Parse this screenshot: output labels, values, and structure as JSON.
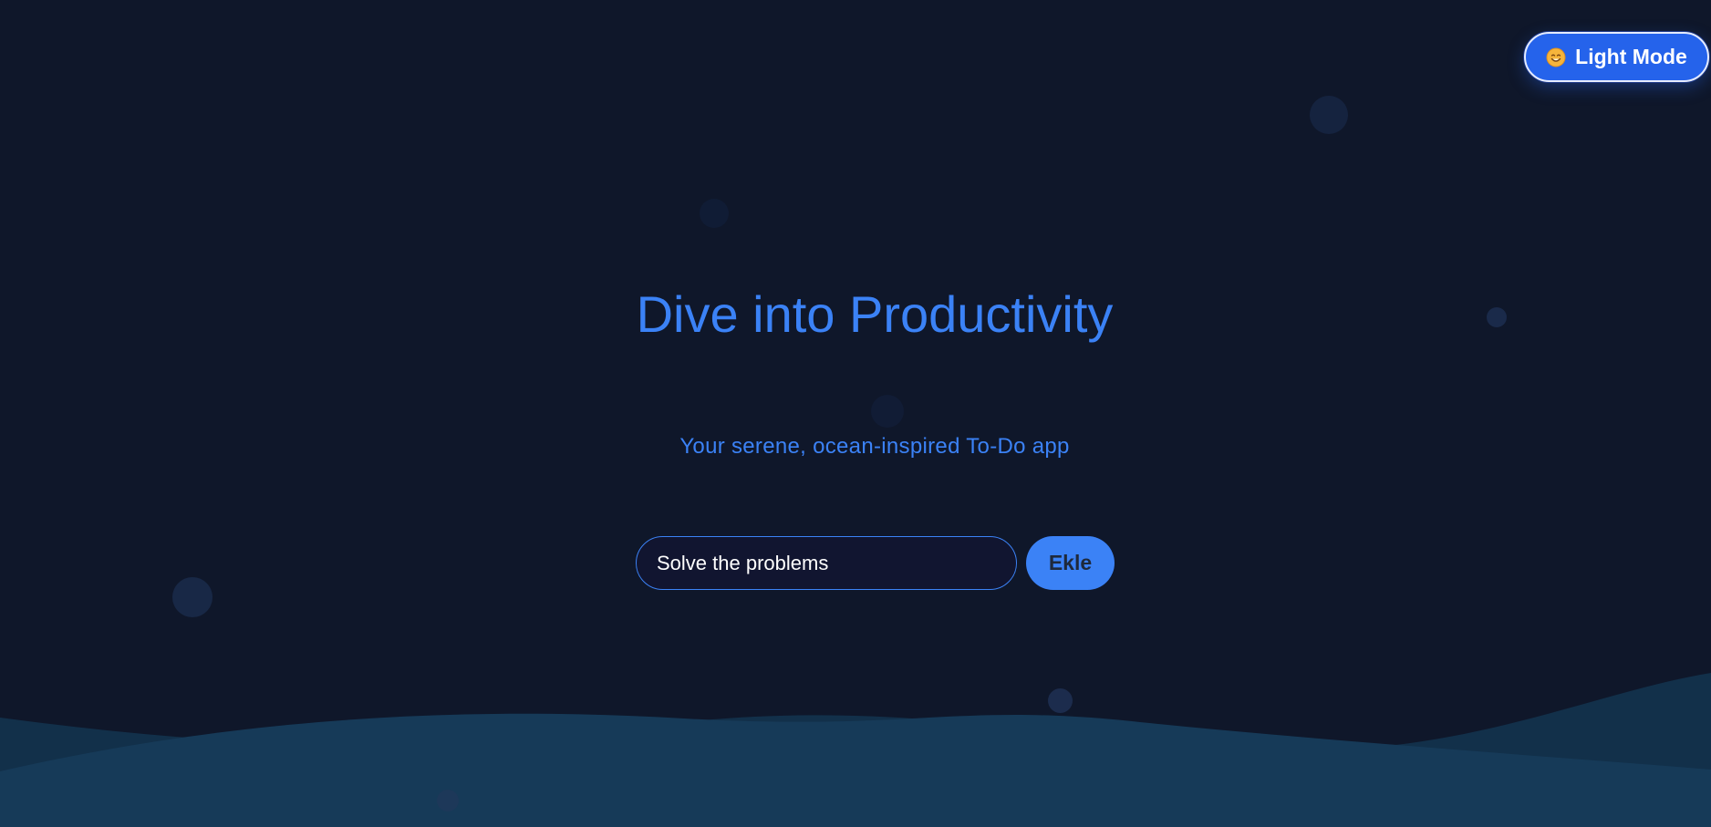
{
  "theme_toggle": {
    "icon": "sun-face-icon",
    "label": "Light Mode",
    "accent": "#2563eb"
  },
  "hero": {
    "title": "Dive into Productivity",
    "subtitle": "Your serene, ocean-inspired To-Do app"
  },
  "task_form": {
    "input_value": "Solve the problems",
    "add_label": "Ekle"
  },
  "colors": {
    "background": "#0f172a",
    "accent": "#3b82f6",
    "wave": "#163a58"
  }
}
